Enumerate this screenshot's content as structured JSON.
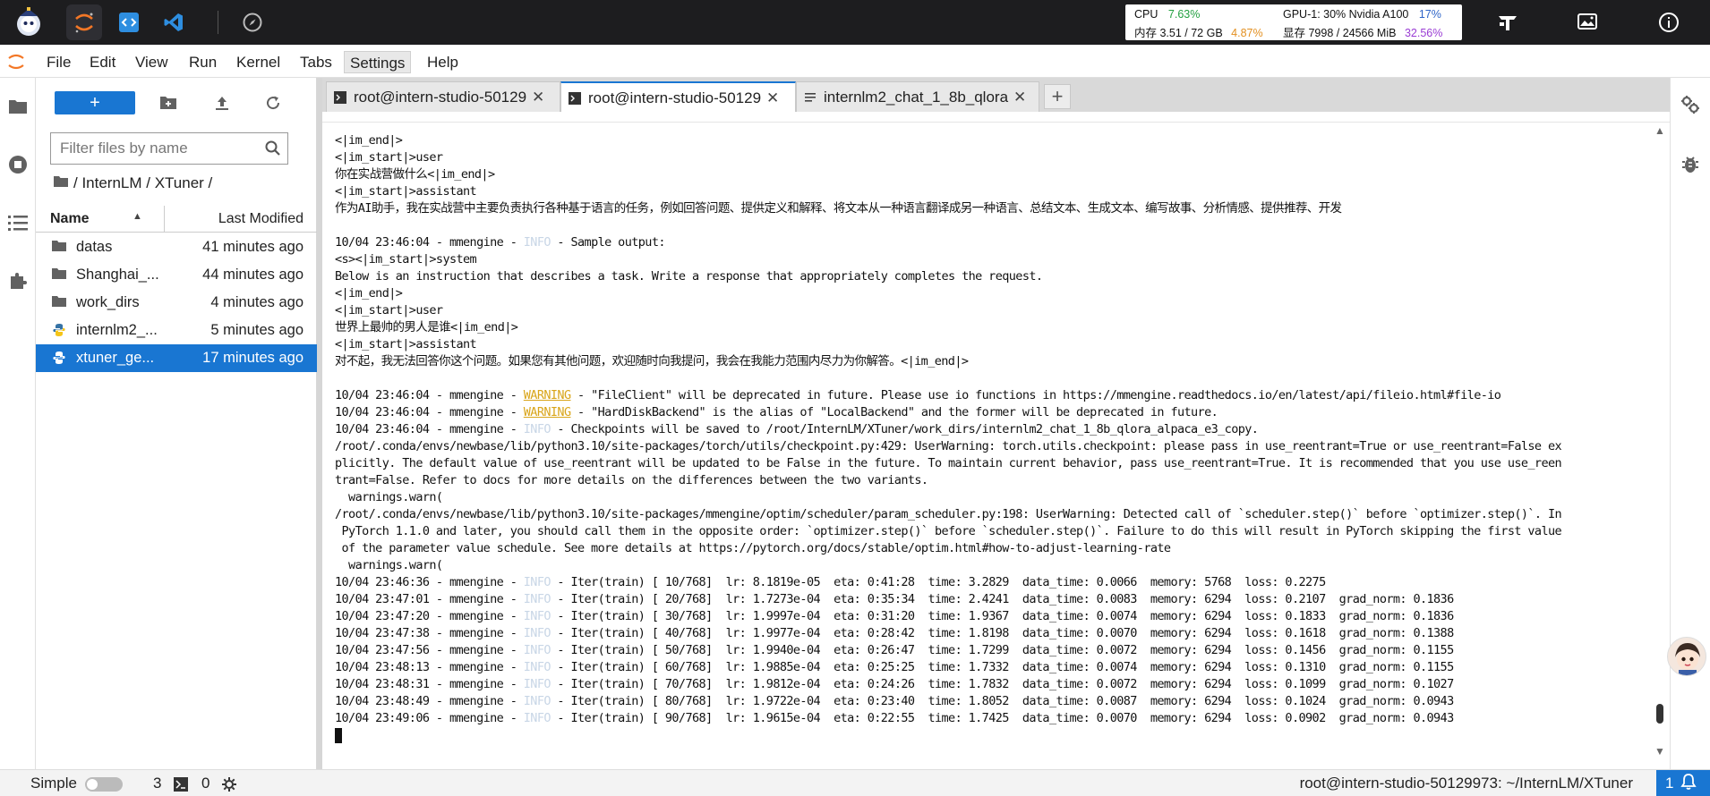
{
  "topbar": {
    "stats": {
      "cpu_label": "CPU",
      "cpu_value": "7.63%",
      "mem_label": "内存 3.51 / 72 GB",
      "mem_value": "4.87%",
      "gpu_label": "GPU-1: 30% Nvidia A100",
      "gpu_value": "17%",
      "vram_label": "显存 7998 / 24566 MiB",
      "vram_value": "32.56%"
    }
  },
  "menu": {
    "items": [
      "File",
      "Edit",
      "View",
      "Run",
      "Kernel",
      "Tabs",
      "Settings",
      "Help"
    ]
  },
  "filebrowser": {
    "new_label": "+",
    "filter_placeholder": "Filter files by name",
    "breadcrumb": "/ InternLM / XTuner /",
    "col_name": "Name",
    "col_modified": "Last Modified",
    "rows": [
      {
        "name": "datas",
        "modified": "41 minutes ago",
        "type": "folder"
      },
      {
        "name": "Shanghai_...",
        "modified": "44 minutes ago",
        "type": "folder"
      },
      {
        "name": "work_dirs",
        "modified": "4 minutes ago",
        "type": "folder"
      },
      {
        "name": "internlm2_...",
        "modified": "5 minutes ago",
        "type": "python"
      },
      {
        "name": "xtuner_ge...",
        "modified": "17 minutes ago",
        "type": "python"
      }
    ]
  },
  "tabs": [
    {
      "label": "root@intern-studio-50129",
      "icon": "terminal-icon"
    },
    {
      "label": "root@intern-studio-50129",
      "icon": "terminal-icon"
    },
    {
      "label": "internlm2_chat_1_8b_qlora",
      "icon": "text-file-icon"
    }
  ],
  "terminal": {
    "lines": [
      [
        [
          "t",
          "<|im_end|>"
        ]
      ],
      [
        [
          "t",
          "<|im_start|>user"
        ]
      ],
      [
        [
          "t",
          "你在实战营做什么<|im_end|>"
        ]
      ],
      [
        [
          "t",
          "<|im_start|>assistant"
        ]
      ],
      [
        [
          "t",
          "作为AI助手，我在实战营中主要负责执行各种基于语言的任务，例如回答问题、提供定义和解释、将文本从一种语言翻译成另一种语言、总结文本、生成文本、编写故事、分析情感、提供推荐、开发"
        ]
      ],
      [
        [
          "t",
          ""
        ]
      ],
      [
        [
          "t",
          "10/04 23:46:04 - mmengine - "
        ],
        [
          "i",
          "INFO"
        ],
        [
          "t",
          " - Sample output:"
        ]
      ],
      [
        [
          "t",
          "<s><|im_start|>system"
        ]
      ],
      [
        [
          "t",
          "Below is an instruction that describes a task. Write a response that appropriately completes the request."
        ]
      ],
      [
        [
          "t",
          "<|im_end|>"
        ]
      ],
      [
        [
          "t",
          "<|im_start|>user"
        ]
      ],
      [
        [
          "t",
          "世界上最帅的男人是谁<|im_end|>"
        ]
      ],
      [
        [
          "t",
          "<|im_start|>assistant"
        ]
      ],
      [
        [
          "t",
          "对不起，我无法回答你这个问题。如果您有其他问题，欢迎随时向我提问，我会在我能力范围内尽力为你解答。<|im_end|>"
        ]
      ],
      [
        [
          "t",
          ""
        ]
      ],
      [
        [
          "t",
          "10/04 23:46:04 - mmengine - "
        ],
        [
          "w",
          "WARNING"
        ],
        [
          "t",
          " - \"FileClient\" will be deprecated in future. Please use io functions in https://mmengine.readthedocs.io/en/latest/api/fileio.html#file-io"
        ]
      ],
      [
        [
          "t",
          "10/04 23:46:04 - mmengine - "
        ],
        [
          "w",
          "WARNING"
        ],
        [
          "t",
          " - \"HardDiskBackend\" is the alias of \"LocalBackend\" and the former will be deprecated in future."
        ]
      ],
      [
        [
          "t",
          "10/04 23:46:04 - mmengine - "
        ],
        [
          "i",
          "INFO"
        ],
        [
          "t",
          " - Checkpoints will be saved to /root/InternLM/XTuner/work_dirs/internlm2_chat_1_8b_qlora_alpaca_e3_copy."
        ]
      ],
      [
        [
          "t",
          "/root/.conda/envs/newbase/lib/python3.10/site-packages/torch/utils/checkpoint.py:429: UserWarning: torch.utils.checkpoint: please pass in use_reentrant=True or use_reentrant=False ex"
        ]
      ],
      [
        [
          "t",
          "plicitly. The default value of use_reentrant will be updated to be False in the future. To maintain current behavior, pass use_reentrant=True. It is recommended that you use use_reen"
        ]
      ],
      [
        [
          "t",
          "trant=False. Refer to docs for more details on the differences between the two variants."
        ]
      ],
      [
        [
          "t",
          "  warnings.warn("
        ]
      ],
      [
        [
          "t",
          "/root/.conda/envs/newbase/lib/python3.10/site-packages/mmengine/optim/scheduler/param_scheduler.py:198: UserWarning: Detected call of `scheduler.step()` before `optimizer.step()`. In"
        ]
      ],
      [
        [
          "t",
          " PyTorch 1.1.0 and later, you should call them in the opposite order: `optimizer.step()` before `scheduler.step()`. Failure to do this will result in PyTorch skipping the first value"
        ]
      ],
      [
        [
          "t",
          " of the parameter value schedule. See more details at https://pytorch.org/docs/stable/optim.html#how-to-adjust-learning-rate"
        ]
      ],
      [
        [
          "t",
          "  warnings.warn("
        ]
      ],
      [
        [
          "t",
          "10/04 23:46:36 - mmengine - "
        ],
        [
          "i",
          "INFO"
        ],
        [
          "t",
          " - Iter(train) [ 10/768]  lr: 8.1819e-05  eta: 0:41:28  time: 3.2829  data_time: 0.0066  memory: 5768  loss: 0.2275"
        ]
      ],
      [
        [
          "t",
          "10/04 23:47:01 - mmengine - "
        ],
        [
          "i",
          "INFO"
        ],
        [
          "t",
          " - Iter(train) [ 20/768]  lr: 1.7273e-04  eta: 0:35:34  time: 2.4241  data_time: 0.0083  memory: 6294  loss: 0.2107  grad_norm: 0.1836"
        ]
      ],
      [
        [
          "t",
          "10/04 23:47:20 - mmengine - "
        ],
        [
          "i",
          "INFO"
        ],
        [
          "t",
          " - Iter(train) [ 30/768]  lr: 1.9997e-04  eta: 0:31:20  time: 1.9367  data_time: 0.0074  memory: 6294  loss: 0.1833  grad_norm: 0.1836"
        ]
      ],
      [
        [
          "t",
          "10/04 23:47:38 - mmengine - "
        ],
        [
          "i",
          "INFO"
        ],
        [
          "t",
          " - Iter(train) [ 40/768]  lr: 1.9977e-04  eta: 0:28:42  time: 1.8198  data_time: 0.0070  memory: 6294  loss: 0.1618  grad_norm: 0.1388"
        ]
      ],
      [
        [
          "t",
          "10/04 23:47:56 - mmengine - "
        ],
        [
          "i",
          "INFO"
        ],
        [
          "t",
          " - Iter(train) [ 50/768]  lr: 1.9940e-04  eta: 0:26:47  time: 1.7299  data_time: 0.0072  memory: 6294  loss: 0.1456  grad_norm: 0.1155"
        ]
      ],
      [
        [
          "t",
          "10/04 23:48:13 - mmengine - "
        ],
        [
          "i",
          "INFO"
        ],
        [
          "t",
          " - Iter(train) [ 60/768]  lr: 1.9885e-04  eta: 0:25:25  time: 1.7332  data_time: 0.0074  memory: 6294  loss: 0.1310  grad_norm: 0.1155"
        ]
      ],
      [
        [
          "t",
          "10/04 23:48:31 - mmengine - "
        ],
        [
          "i",
          "INFO"
        ],
        [
          "t",
          " - Iter(train) [ 70/768]  lr: 1.9812e-04  eta: 0:24:26  time: 1.7832  data_time: 0.0072  memory: 6294  loss: 0.1099  grad_norm: 0.1027"
        ]
      ],
      [
        [
          "t",
          "10/04 23:48:49 - mmengine - "
        ],
        [
          "i",
          "INFO"
        ],
        [
          "t",
          " - Iter(train) [ 80/768]  lr: 1.9722e-04  eta: 0:23:40  time: 1.8052  data_time: 0.0087  memory: 6294  loss: 0.1024  grad_norm: 0.0943"
        ]
      ],
      [
        [
          "t",
          "10/04 23:49:06 - mmengine - "
        ],
        [
          "i",
          "INFO"
        ],
        [
          "t",
          " - Iter(train) [ 90/768]  lr: 1.9615e-04  eta: 0:22:55  time: 1.7425  data_time: 0.0070  memory: 6294  loss: 0.0902  grad_norm: 0.0943"
        ]
      ]
    ]
  },
  "statusbar": {
    "simple_label": "Simple",
    "count_a": "3",
    "count_b": "0",
    "path": "root@intern-studio-50129973: ~/InternLM/XTuner",
    "notifications": "1"
  },
  "colors": {
    "accent": "#1976d2",
    "topbar_bg": "#1d1d1f",
    "warning": "#d9a51a",
    "info": "#c8d6e6"
  }
}
